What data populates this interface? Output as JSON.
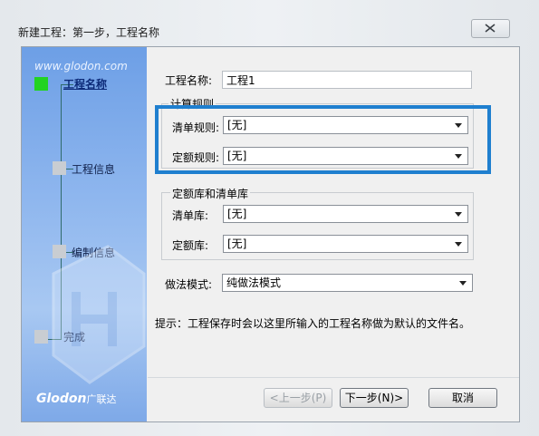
{
  "window": {
    "title": "新建工程：第一步，工程名称"
  },
  "banner": {
    "site": "www.glodon.com",
    "steps": [
      {
        "label": "工程名称",
        "active": true
      },
      {
        "label": "工程信息",
        "active": false
      },
      {
        "label": "编制信息",
        "active": false
      },
      {
        "label": "完成",
        "active": false
      }
    ],
    "brand": "Glodon",
    "brand_cn": "广联达"
  },
  "form": {
    "project_name_label": "工程名称:",
    "project_name_value": "工程1",
    "calc_rules": {
      "title": "计算规则",
      "bill_rule_label": "清单规则:",
      "bill_rule_value": "[无]",
      "quota_rule_label": "定额规则:",
      "quota_rule_value": "[无]"
    },
    "libraries": {
      "title": "定额库和清单库",
      "bill_lib_label": "清单库:",
      "bill_lib_value": "[无]",
      "quota_lib_label": "定额库:",
      "quota_lib_value": "[无]"
    },
    "method_label": "做法模式:",
    "method_value": "纯做法模式",
    "hint": "提示：工程保存时会以这里所输入的工程名称做为默认的文件名。"
  },
  "buttons": {
    "prev": "<上一步(P)",
    "next": "下一步(N)>",
    "cancel": "取消"
  },
  "colors": {
    "highlight": "#1f7fcf",
    "active_step": "#22d322"
  }
}
